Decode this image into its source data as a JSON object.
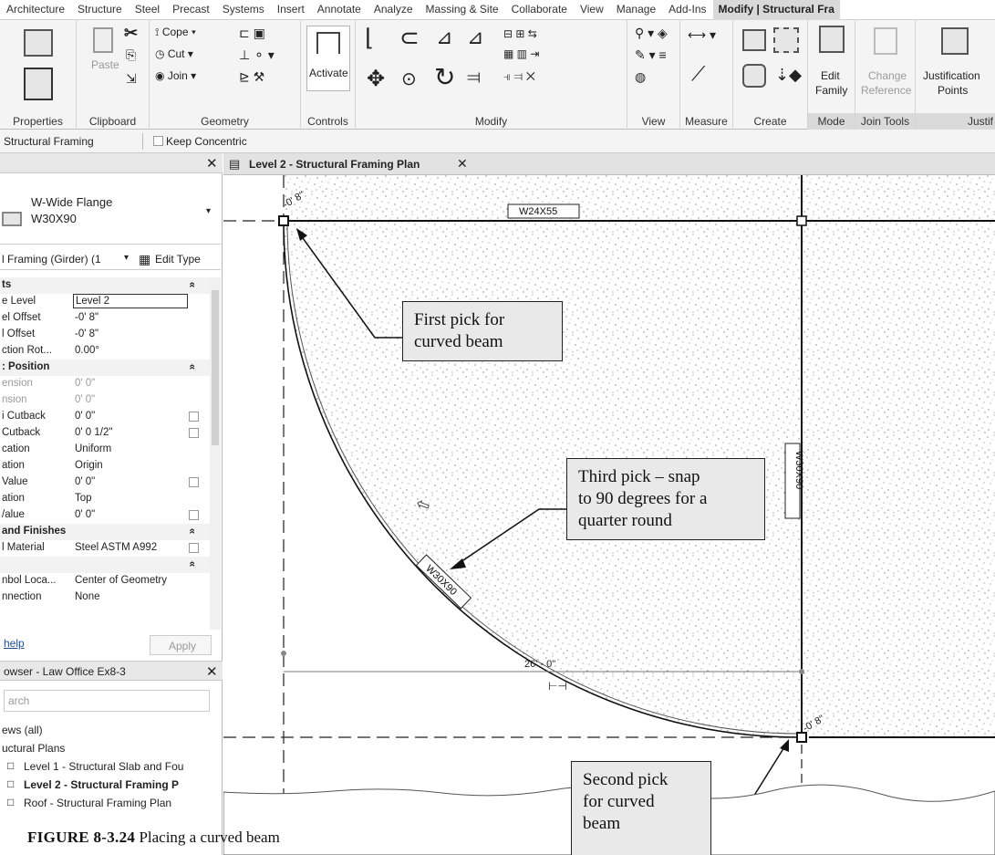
{
  "ribbon": {
    "tabs": [
      "Architecture",
      "Structure",
      "Steel",
      "Precast",
      "Systems",
      "Insert",
      "Annotate",
      "Analyze",
      "Massing & Site",
      "Collaborate",
      "View",
      "Manage",
      "Add-Ins"
    ],
    "active_tab": "Modify | Structural Fra",
    "panels": {
      "properties": "Properties",
      "clipboard": "Clipboard",
      "geometry": "Geometry",
      "controls": "Controls",
      "modify": "Modify",
      "view": "View",
      "measure": "Measure",
      "create": "Create",
      "mode": "Mode",
      "join_tools": "Join Tools",
      "justification": "Justif"
    },
    "buttons": {
      "paste": "Paste",
      "cope": "Cope",
      "cut": "Cut",
      "join": "Join",
      "activate": "Activate",
      "edit_family_1": "Edit",
      "edit_family_2": "Family",
      "change_reference_1": "Change",
      "change_reference_2": "Reference",
      "justification_points_1": "Justification",
      "justification_points_2": "Points"
    }
  },
  "options_bar": {
    "label": "Structural Framing",
    "keep_concentric": "Keep Concentric",
    "keep_concentric_checked": false
  },
  "properties_palette": {
    "family_name": "W-Wide Flange",
    "type_name": "W30X90",
    "instance_filter": "l Framing (Girder) (1",
    "edit_type": "Edit Type",
    "rows": [
      {
        "k": "ts",
        "v": "",
        "section": true
      },
      {
        "k": "e Level",
        "v": "Level 2",
        "boxed": true
      },
      {
        "k": "el Offset",
        "v": "-0'  8\""
      },
      {
        "k": "l Offset",
        "v": "-0'  8\""
      },
      {
        "k": "ction Rot...",
        "v": "0.00°"
      },
      {
        "k": ": Position",
        "v": "",
        "section": true
      },
      {
        "k": "ension",
        "v": "0'  0\"",
        "gray": true
      },
      {
        "k": "nsion",
        "v": "0'  0\"",
        "gray": true
      },
      {
        "k": "i Cutback",
        "v": "0'  0\"",
        "check": true
      },
      {
        "k": " Cutback",
        "v": "0'  0 1/2\"",
        "check": true
      },
      {
        "k": "cation",
        "v": "Uniform"
      },
      {
        "k": "ation",
        "v": "Origin"
      },
      {
        "k": "Value",
        "v": "0'  0\"",
        "check": true
      },
      {
        "k": "ation",
        "v": "Top"
      },
      {
        "k": "/alue",
        "v": "0'  0\"",
        "check": true
      },
      {
        "k": "and Finishes",
        "v": "",
        "section": true
      },
      {
        "k": "l Material",
        "v": "Steel ASTM A992",
        "check": true
      },
      {
        "k": "",
        "v": "",
        "section": true
      },
      {
        "k": "nbol Loca...",
        "v": "Center of Geometry"
      },
      {
        "k": "nnection",
        "v": "None"
      }
    ],
    "help_link": "help",
    "apply": "Apply"
  },
  "project_browser": {
    "title": "owser - Law Office Ex8-3",
    "search_placeholder": "arch",
    "items": [
      {
        "label": "ews (all)",
        "indent": 0
      },
      {
        "label": "uctural Plans",
        "indent": 0
      },
      {
        "label": "Level 1 - Structural Slab and Fou",
        "indent": 1
      },
      {
        "label": "Level 2 - Structural Framing P",
        "indent": 1,
        "bold": true
      },
      {
        "label": "Roof - Structural Framing Plan",
        "indent": 1
      }
    ]
  },
  "view": {
    "tab_title": "Level 2 - Structural Framing Plan",
    "tags": {
      "top_beam": "W24X55",
      "vertical_beam": "W30X90",
      "curved_beam": "W30X90"
    },
    "offset_top": "-0' 8\"",
    "offset_bottom": "-0' 8\"",
    "dimension": "26' - 0\""
  },
  "callouts": {
    "first": [
      "First pick for",
      "curved beam"
    ],
    "third": [
      "Third pick – snap",
      "to 90 degrees for a",
      "quarter round"
    ],
    "second": [
      "Second pick",
      "for curved",
      "beam"
    ]
  },
  "caption": {
    "label": "FIGURE 8-3.24",
    "text": "Placing a curved beam"
  }
}
